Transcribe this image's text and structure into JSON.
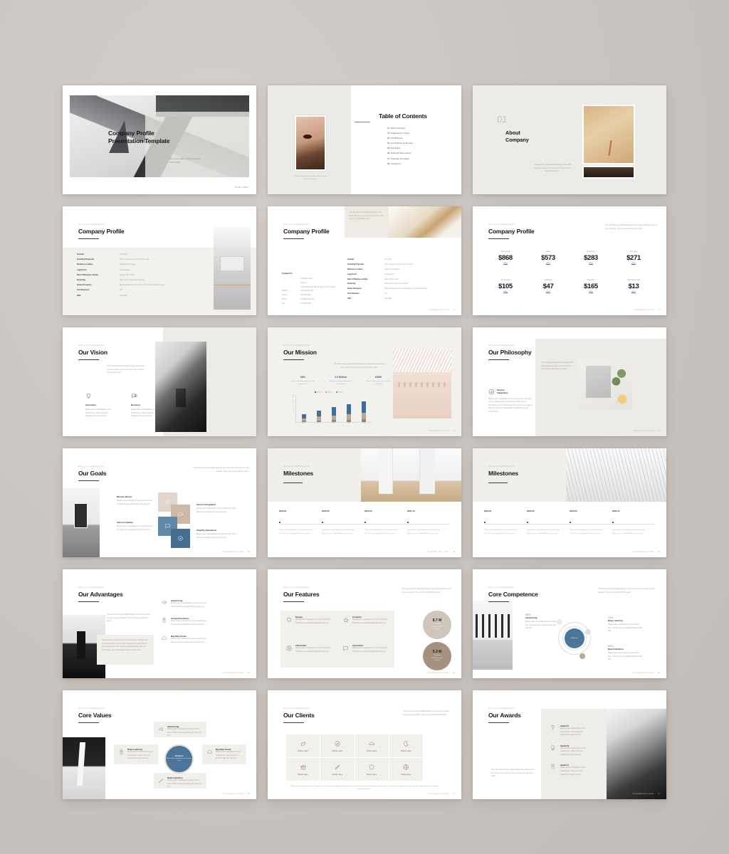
{
  "common": {
    "kicker": "Enter your subheading here",
    "quote": "\"The best and most beautiful things in the world cannot be seen or even touched. They must be felt with the heart.\"",
    "body": "Please enter a description of your content here. This text can be replaced with your own text.",
    "footer_text": "Presentation title or theme",
    "rule": ""
  },
  "slides": [
    {
      "id": "cover",
      "title": "Company Profile\nPresentation Template",
      "subtitle": "Enter a short subtitle or author's name here",
      "subtitle2": "YEAR.00.0000",
      "logo": "YOUR LOGO"
    },
    {
      "id": "table-of-contents",
      "title": "Table of Contents",
      "caption": "\"The greatest happiness of life is the conviction that we are loved.\"",
      "items": [
        {
          "num": "01",
          "label": "About Company"
        },
        {
          "num": "02",
          "label": "Organization & Team"
        },
        {
          "num": "03",
          "label": "Our Business"
        },
        {
          "num": "04",
          "label": "Our Products & Services"
        },
        {
          "num": "05",
          "label": "Our Works"
        },
        {
          "num": "06",
          "label": "Financial Performance"
        },
        {
          "num": "07",
          "label": "Financial Information"
        },
        {
          "num": "08",
          "label": "Contact Us"
        }
      ]
    },
    {
      "id": "section-about",
      "number": "01",
      "title": "About\nCompany"
    },
    {
      "id": "company-profile-table",
      "title": "Company Profile",
      "rows": [
        {
          "k": "Founder",
          "v": "John Doe"
        },
        {
          "k": "Founding Proposals",
          "v": "Short sentence to your business idea"
        },
        {
          "k": "Business Location",
          "v": "Address of company"
        },
        {
          "k": "Legal Form",
          "v": "Incorporated"
        },
        {
          "k": "Start of Business activity",
          "v": "August 16th, 2010"
        },
        {
          "k": "Financing",
          "v": "How will the project be financed"
        },
        {
          "k": "Future Prospects",
          "v": "Brief description to the perspective of your business idea"
        },
        {
          "k": "Core Business",
          "v": "IOT"
        },
        {
          "k": "CEO",
          "v": "John Doe"
        }
      ]
    },
    {
      "id": "company-profile-contacts",
      "title": "Company Profile",
      "contact_heading": "Contact Us",
      "contacts": [
        {
          "k": "",
          "v": "Company Name"
        },
        {
          "k": "",
          "v": "Address"
        },
        {
          "k": "",
          "v": "Central Park N & 79th St New York, NY 10024"
        },
        {
          "k": "Website",
          "v": "www.domain.com"
        },
        {
          "k": "Phone",
          "v": "123.456.7890"
        },
        {
          "k": "Email",
          "v": "email@email.com"
        },
        {
          "k": "Fax",
          "v": "123.456.7890"
        }
      ],
      "rows": [
        {
          "k": "Founder",
          "v": "John Doe"
        },
        {
          "k": "Founding Proposals",
          "v": "Short sentence to your business idea"
        },
        {
          "k": "Business Location",
          "v": "Address of company"
        },
        {
          "k": "Legal Form",
          "v": "Incorporated"
        },
        {
          "k": "Start of Business activity",
          "v": "August 16th, 2010"
        },
        {
          "k": "Financing",
          "v": "How will the project be financed"
        },
        {
          "k": "Future Prospects",
          "v": "Brief description to the perspective of your business idea"
        },
        {
          "k": "Core Business",
          "v": "IOT"
        },
        {
          "k": "CEO",
          "v": "John Doe"
        }
      ]
    },
    {
      "id": "company-profile-stats",
      "title": "Company Profile",
      "unit": "million",
      "stats": [
        {
          "label": "Total Assets",
          "value": "$868"
        },
        {
          "label": "Sales",
          "value": "$573"
        },
        {
          "label": "Expenses",
          "value": "$283"
        },
        {
          "label": "Revenue",
          "value": "$271"
        },
        {
          "label": "Net Income",
          "value": "$105"
        },
        {
          "label": "Liabilities",
          "value": "$47"
        },
        {
          "label": "Deposits",
          "value": "$165"
        },
        {
          "label": "Total Taxes Paid",
          "value": "$13"
        }
      ]
    },
    {
      "id": "our-vision",
      "title": "Our Vision",
      "items": [
        {
          "icon": "lightbulb-icon",
          "label": "Innovation"
        },
        {
          "icon": "chat-icon",
          "label": "Business"
        }
      ]
    },
    {
      "id": "our-mission",
      "title": "Our Mission",
      "kpis": [
        {
          "value": "68%",
          "desc": "Please enter a description of your content here"
        },
        {
          "value": "2.5 Billion",
          "desc": "Please enter a description of your content here"
        },
        {
          "value": "630M",
          "desc": "Please enter a description of your content here"
        }
      ]
    },
    {
      "id": "our-philosophy",
      "title": "Our Philosophy",
      "item_label": "Service\nIntegration",
      "item_body": "Please enter a description of your content here. This text can be replaced with your own text. Please enter a description of your content here. This text can be replaced with your own text. Please enter a description of your content here."
    },
    {
      "id": "our-goals",
      "title": "Our Goals",
      "items": [
        {
          "label": "Mission Driven",
          "color": "#e1d5cc"
        },
        {
          "label": "Service Integration",
          "color": "#cbb8a6"
        },
        {
          "label": "Improve Quality",
          "color": "#5f87a8"
        },
        {
          "label": "Simplify Operations",
          "color": "#456e90"
        }
      ]
    },
    {
      "id": "milestones-a",
      "title": "Milestones",
      "dates": [
        "2020.01",
        "2020.05",
        "2021.03",
        "2021.12"
      ]
    },
    {
      "id": "milestones-b",
      "title": "Milestones",
      "dates": [
        "2022.01",
        "2022.05",
        "2023.03",
        "2023.12"
      ]
    },
    {
      "id": "our-advantages",
      "title": "Our Advantages",
      "box_body": "Please enter a description of your content here. This text can be replaced with your own text. Please enter a description of your content here. This text can be replaced with your own text. Please enter a description of your content here.",
      "items": [
        {
          "icon": "megaphone-icon",
          "label": "Advertising"
        },
        {
          "icon": "mobile-pay-icon",
          "label": "In-App Purchases"
        },
        {
          "icon": "cloud-icon",
          "label": "Big Data Cloud"
        }
      ]
    },
    {
      "id": "our-features",
      "title": "Our Features",
      "cells": [
        {
          "icon": "heart-icon",
          "label": "Design"
        },
        {
          "icon": "star-icon",
          "label": "Contents"
        },
        {
          "icon": "cursor-icon",
          "label": "Interaction"
        },
        {
          "icon": "chat-icon",
          "label": "Innovation"
        }
      ],
      "circles": [
        {
          "value": "8.7 M",
          "desc": "Registered\nSubscribers to the\nnew year"
        },
        {
          "value": "5.3 M",
          "desc": "Registered\nSubscribers to the\nlast year"
        }
      ]
    },
    {
      "id": "core-competence",
      "title": "Core Competence",
      "center_label": "Motivation",
      "items": [
        {
          "pct": "85%",
          "label": "Advertising"
        },
        {
          "pct": "73%",
          "label": "Deep Learning"
        },
        {
          "pct": "62%",
          "label": "Data Collection"
        }
      ]
    },
    {
      "id": "core-values",
      "title": "Core Values",
      "hub": {
        "label": "Motivation",
        "desc": "Please enter a description of your content here"
      },
      "cards": [
        {
          "icon": "megaphone-icon",
          "label": "Advertising"
        },
        {
          "icon": "mobile-pay-icon",
          "label": "Deep Learning"
        },
        {
          "icon": "cloud-icon",
          "label": "Big Data Cloud"
        },
        {
          "icon": "pencil-icon",
          "label": "Data Collection"
        }
      ]
    },
    {
      "id": "our-clients",
      "title": "Our Clients",
      "partner_label": "Partner name",
      "note": "Please enter a description of your content here. This text can be replaced with your own text. Please enter a description of your content here. This text can be replaced with your own text. Please enter a description of your content here.",
      "icons": [
        "leaf-icon",
        "compass-icon",
        "bridge-icon",
        "moon-icon",
        "bank-icon",
        "rocket-icon",
        "shield-icon",
        "globe-icon"
      ]
    },
    {
      "id": "our-awards",
      "title": "Our Awards",
      "items": [
        {
          "icon": "trophy-icon",
          "label": "Award A"
        },
        {
          "icon": "badge-icon",
          "label": "Award B"
        },
        {
          "icon": "medal-icon",
          "label": "Award C"
        }
      ]
    }
  ],
  "chart_data": {
    "type": "bar",
    "title": "Our Mission stacked bar chart",
    "categories": [
      "2020",
      "2021",
      "2022",
      "2023",
      "2024"
    ],
    "series": [
      {
        "name": "Series 1",
        "values": [
          20,
          32,
          42,
          52,
          60
        ]
      },
      {
        "name": "Series 2",
        "values": [
          14,
          20,
          24,
          30,
          34
        ]
      },
      {
        "name": "Series 3",
        "values": [
          6,
          8,
          10,
          12,
          14
        ]
      }
    ],
    "ylim": [
      0,
      140
    ],
    "yticks": [
      "140",
      "120",
      "100",
      "80",
      "60",
      "40",
      "20",
      "0"
    ],
    "legend": [
      "Series 1",
      "Series 2",
      "Series 3"
    ],
    "legend_position": "top",
    "grid": false,
    "xlabel": "",
    "ylabel": ""
  }
}
